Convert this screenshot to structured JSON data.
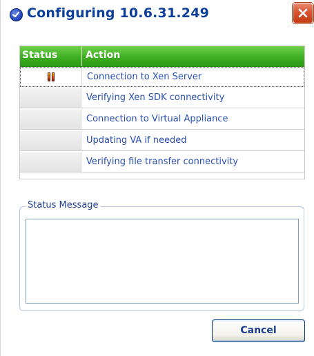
{
  "dialog": {
    "title": "Configuring 10.6.31.249",
    "app_icon": "check-circle-icon",
    "close_icon": "close-icon"
  },
  "table": {
    "columns": [
      "Status",
      "Action"
    ],
    "header_color": "#3eae22",
    "rows": [
      {
        "status_icon": "pause-icon",
        "action": "Connection to Xen Server",
        "selected": true
      },
      {
        "status_icon": "",
        "action": "Verifying Xen SDK connectivity",
        "selected": false
      },
      {
        "status_icon": "",
        "action": "Connection to Virtual Appliance",
        "selected": false
      },
      {
        "status_icon": "",
        "action": "Updating VA if needed",
        "selected": false
      },
      {
        "status_icon": "",
        "action": "Verifying file transfer connectivity",
        "selected": false
      }
    ]
  },
  "status_group": {
    "label": "Status Message",
    "message": ""
  },
  "buttons": {
    "cancel_label": "Cancel"
  }
}
